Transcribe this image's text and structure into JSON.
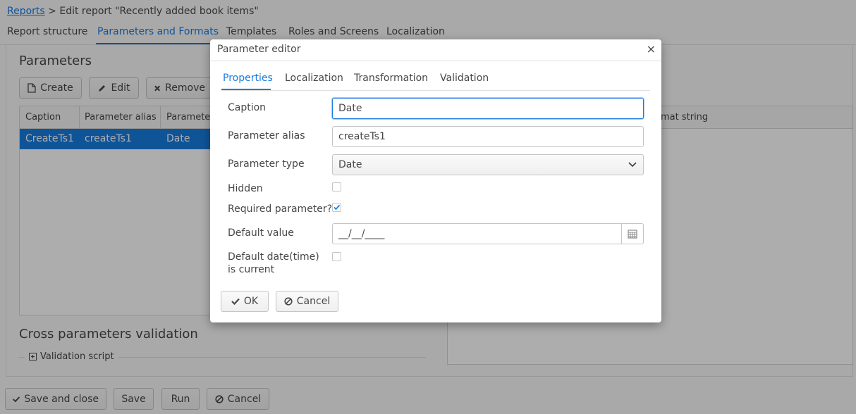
{
  "breadcrumb": {
    "link": "Reports",
    "separator": ">",
    "current": "Edit report \"Recently added book items\""
  },
  "main_tabs": [
    {
      "label": "Report structure"
    },
    {
      "label": "Parameters and Formats"
    },
    {
      "label": "Templates"
    },
    {
      "label": "Roles and Screens"
    },
    {
      "label": "Localization"
    }
  ],
  "parameters": {
    "title": "Parameters",
    "buttons": {
      "create": "Create",
      "edit": "Edit",
      "remove": "Remove"
    },
    "columns": [
      "Caption",
      "Parameter alias",
      "Parameter"
    ],
    "rows": [
      {
        "caption": "CreateTs1",
        "alias": "createTs1",
        "type": "Date"
      }
    ]
  },
  "formats": {
    "column": "mat string"
  },
  "cross_validation": {
    "title": "Cross parameters validation",
    "script_label": "Validation script"
  },
  "footer_buttons": {
    "save_close": "Save and close",
    "save": "Save",
    "run": "Run",
    "cancel": "Cancel"
  },
  "dialog": {
    "title": "Parameter editor",
    "close": "×",
    "tabs": [
      {
        "label": "Properties"
      },
      {
        "label": "Localization"
      },
      {
        "label": "Transformation"
      },
      {
        "label": "Validation"
      }
    ],
    "fields": {
      "caption": {
        "label": "Caption",
        "value": "Date"
      },
      "alias": {
        "label": "Parameter alias",
        "value": "createTs1"
      },
      "type": {
        "label": "Parameter type",
        "value": "Date"
      },
      "hidden": {
        "label": "Hidden",
        "checked": false
      },
      "required": {
        "label": "Required parameter?",
        "checked": true
      },
      "default_value": {
        "label": "Default value",
        "value": "__/__/____"
      },
      "default_current": {
        "label_line1": "Default date(time)",
        "label_line2": "is current",
        "checked": false
      }
    },
    "buttons": {
      "ok": "OK",
      "cancel": "Cancel"
    }
  },
  "colors": {
    "accent": "#197de1",
    "overlay": "rgba(0,0,0,0.32)"
  }
}
